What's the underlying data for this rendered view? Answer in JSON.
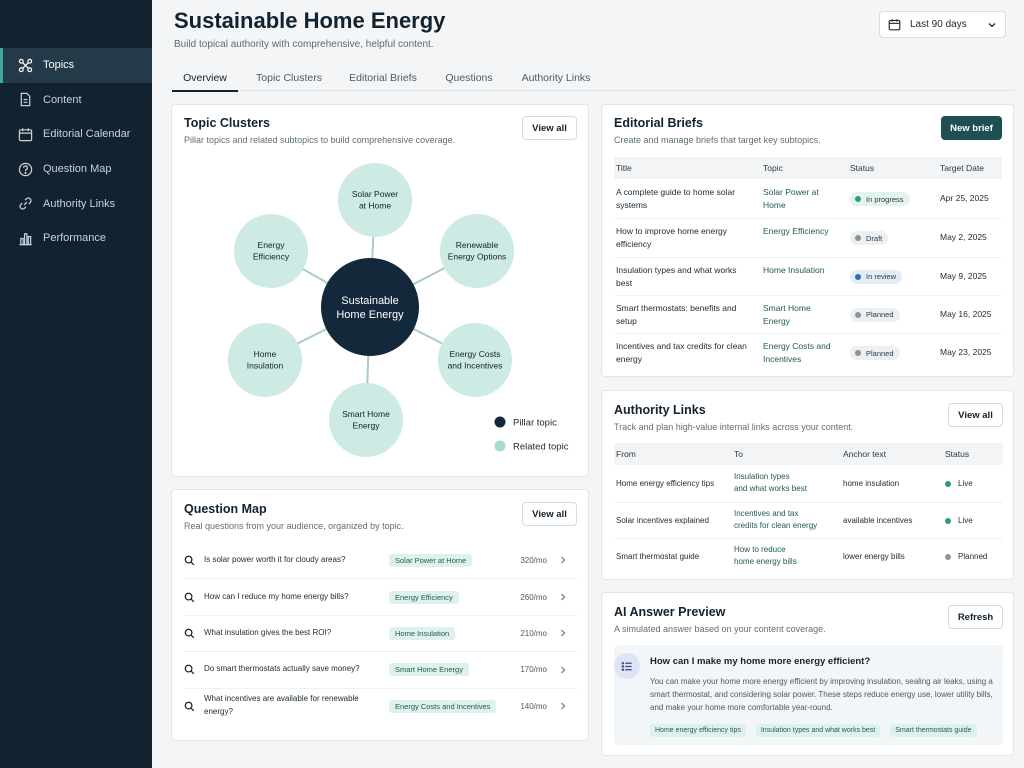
{
  "sidebar": {
    "items": [
      {
        "label": "Topics",
        "icon": "topics-icon",
        "active": true
      },
      {
        "label": "Content",
        "icon": "document-icon",
        "active": false
      },
      {
        "label": "Editorial Calendar",
        "icon": "calendar-icon",
        "active": false
      },
      {
        "label": "Question Map",
        "icon": "question-icon",
        "active": false
      },
      {
        "label": "Authority Links",
        "icon": "link-icon",
        "active": false
      },
      {
        "label": "Performance",
        "icon": "bar-chart-icon",
        "active": false
      }
    ]
  },
  "header": {
    "title": "Sustainable Home Energy",
    "subtitle": "Build topical authority with comprehensive, helpful content.",
    "date_range": "Last 90 days"
  },
  "tabs": [
    {
      "label": "Overview",
      "active": true
    },
    {
      "label": "Topic Clusters",
      "active": false
    },
    {
      "label": "Editorial Briefs",
      "active": false
    },
    {
      "label": "Questions",
      "active": false
    },
    {
      "label": "Authority Links",
      "active": false
    }
  ],
  "topic_clusters": {
    "title": "Topic Clusters",
    "subtitle": "Pillar topics and related subtopics to build comprehensive coverage.",
    "view_all": "View all",
    "pillar": [
      "Sustainable",
      "Home Energy"
    ],
    "related": [
      [
        "Solar Power",
        "at Home"
      ],
      [
        "Renewable",
        "Energy Options"
      ],
      [
        "Energy Costs",
        "and Incentives"
      ],
      [
        "Smart Home",
        "Energy"
      ],
      [
        "Home",
        "Insulation"
      ],
      [
        "Energy",
        "Efficiency"
      ]
    ],
    "legend": [
      {
        "label": "Pillar topic",
        "color": "#13283a"
      },
      {
        "label": "Related topic",
        "color": "#a8dcd1"
      }
    ]
  },
  "question_map": {
    "title": "Question Map",
    "subtitle": "Real questions from your audience, organized by topic.",
    "view_all": "View all",
    "rows": [
      {
        "question": "Is solar power worth it for cloudy areas?",
        "topic": "Solar Power at Home",
        "volume": "320/mo"
      },
      {
        "question": "How can I reduce my home energy bills?",
        "topic": "Energy Efficiency",
        "volume": "260/mo"
      },
      {
        "question": "What insulation gives the best ROI?",
        "topic": "Home Insulation",
        "volume": "210/mo"
      },
      {
        "question": "Do smart thermostats actually save money?",
        "topic": "Smart Home Energy",
        "volume": "170/mo"
      },
      {
        "question": "What incentives are available for renewable energy?",
        "topic": "Energy Costs and Incentives",
        "volume": "140/mo"
      }
    ]
  },
  "editorial_briefs": {
    "title": "Editorial Briefs",
    "subtitle": "Create and manage briefs that target key subtopics.",
    "new_brief": "New brief",
    "columns": [
      "Title",
      "Topic",
      "Status",
      "Target Date"
    ],
    "rows": [
      {
        "title": "A complete guide to home solar systems",
        "topic": "Solar Power at Home",
        "status": "In progress",
        "status_color": "#2f9e7a",
        "date": "Apr 25, 2025"
      },
      {
        "title": "How to improve home energy efficiency",
        "topic": "Energy Efficiency",
        "status": "Draft",
        "status_color": "#8a949b",
        "date": "May 2, 2025"
      },
      {
        "title": "Insulation types and what works best",
        "topic": "Home Insulation",
        "status": "In review",
        "status_color": "#2f6fb5",
        "date": "May 9, 2025"
      },
      {
        "title": "Smart thermostats: benefits and setup",
        "topic": "Smart Home Energy",
        "status": "Planned",
        "status_color": "#8a949b",
        "date": "May 16, 2025"
      },
      {
        "title": "Incentives and tax credits for clean energy",
        "topic": "Energy Costs and Incentives",
        "status": "Planned",
        "status_color": "#8a949b",
        "date": "May 23, 2025"
      }
    ]
  },
  "authority_links": {
    "title": "Authority Links",
    "subtitle": "Track and plan high-value internal links across your content.",
    "view_all": "View all",
    "columns": [
      "From",
      "To",
      "Anchor text",
      "Status"
    ],
    "rows": [
      {
        "from": "Home energy efficiency tips",
        "to": [
          "Insulation types",
          "and what works best"
        ],
        "anchor": "home insulation",
        "status": "Live",
        "status_color": "#2f9e6a"
      },
      {
        "from": "Solar incentives explained",
        "to": [
          "Incentives and tax",
          "credits for clean energy"
        ],
        "anchor": "available incentives",
        "status": "Live",
        "status_color": "#2f9e6a"
      },
      {
        "from": "Smart thermostat guide",
        "to": [
          "How to reduce",
          "home energy bills"
        ],
        "anchor": "lower energy bills",
        "status": "Planned",
        "status_color": "#8a949b"
      }
    ]
  },
  "ai_preview": {
    "title": "AI Answer Preview",
    "subtitle": "A simulated answer based on your content coverage.",
    "refresh": "Refresh",
    "question": "How can I make my home more energy efficient?",
    "answer": "You can make your home more energy efficient by improving insulation, sealing air leaks, using a smart thermostat, and considering solar power. These steps reduce energy use, lower utility bills, and make your home more comfortable year-round.",
    "chips": [
      "Home energy efficiency tips",
      "Insulation types and what works best",
      "Smart thermostats guide"
    ]
  },
  "colors": {
    "sidebar_bg": "#13222f",
    "accent": "#3fa79b",
    "pillar": "#13283a",
    "related": "#cdeae4",
    "primary_button": "#1f4e55"
  }
}
